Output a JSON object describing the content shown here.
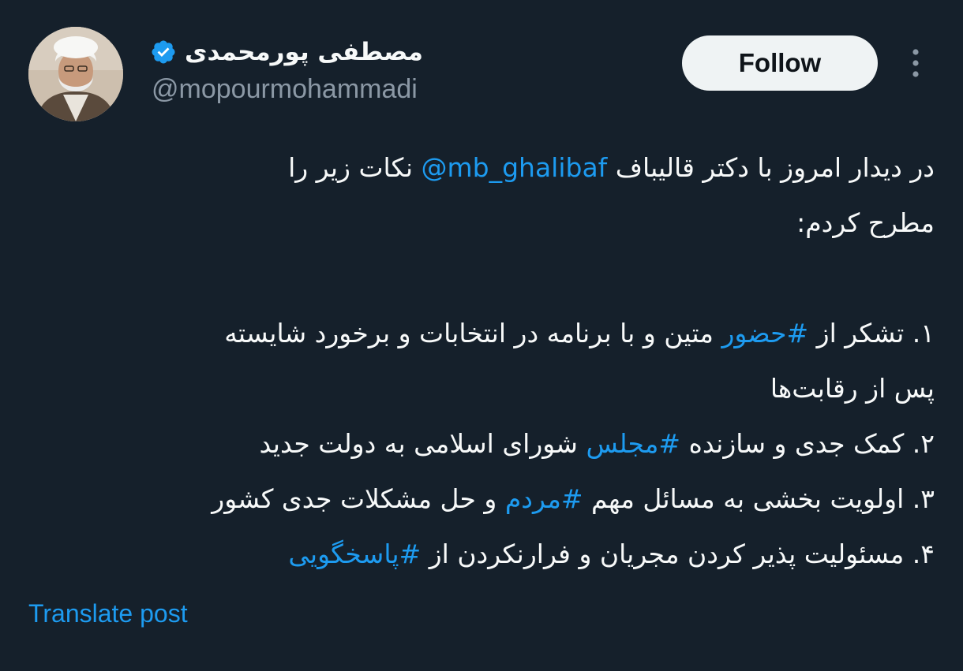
{
  "author": {
    "display_name": "مصطفی پورمحمدی",
    "handle": "@mopourmohammadi",
    "verified": true,
    "avatar_icon": "avatar-portrait"
  },
  "actions": {
    "follow_label": "Follow",
    "more_icon": "more-vertical-icon"
  },
  "tweet": {
    "line1_before": "در دیدار امروز با دکتر قالیباف ",
    "mention": "@mb_ghalibaf",
    "line1_after": " نکات زیر را",
    "line2": "مطرح کردم:",
    "item1_before": "۱. تشکر از ",
    "item1_hashtag": "#حضور",
    "item1_after": " متین و با برنامه در انتخابات و برخورد شایسته",
    "item1_cont": "پس از رقابت‌ها",
    "item2_before": "۲. کمک جدی و سازنده ",
    "item2_hashtag": "#مجلس",
    "item2_after": " شورای اسلامی به دولت جدید",
    "item3_before": "۳. اولویت بخشی به مسائل مهم ",
    "item3_hashtag": "#مردم",
    "item3_after": " و حل مشکلات جدی کشور",
    "item4_before": "۴. مسئولیت پذیر کردن مجریان و فرارنکردن از ",
    "item4_hashtag": "#پاسخگویی"
  },
  "footer": {
    "translate_label": "Translate post"
  },
  "colors": {
    "background": "#15202b",
    "text": "#f7f9f9",
    "secondary": "#8b98a5",
    "accent": "#1d9bf0",
    "follow_bg": "#eff3f4"
  }
}
